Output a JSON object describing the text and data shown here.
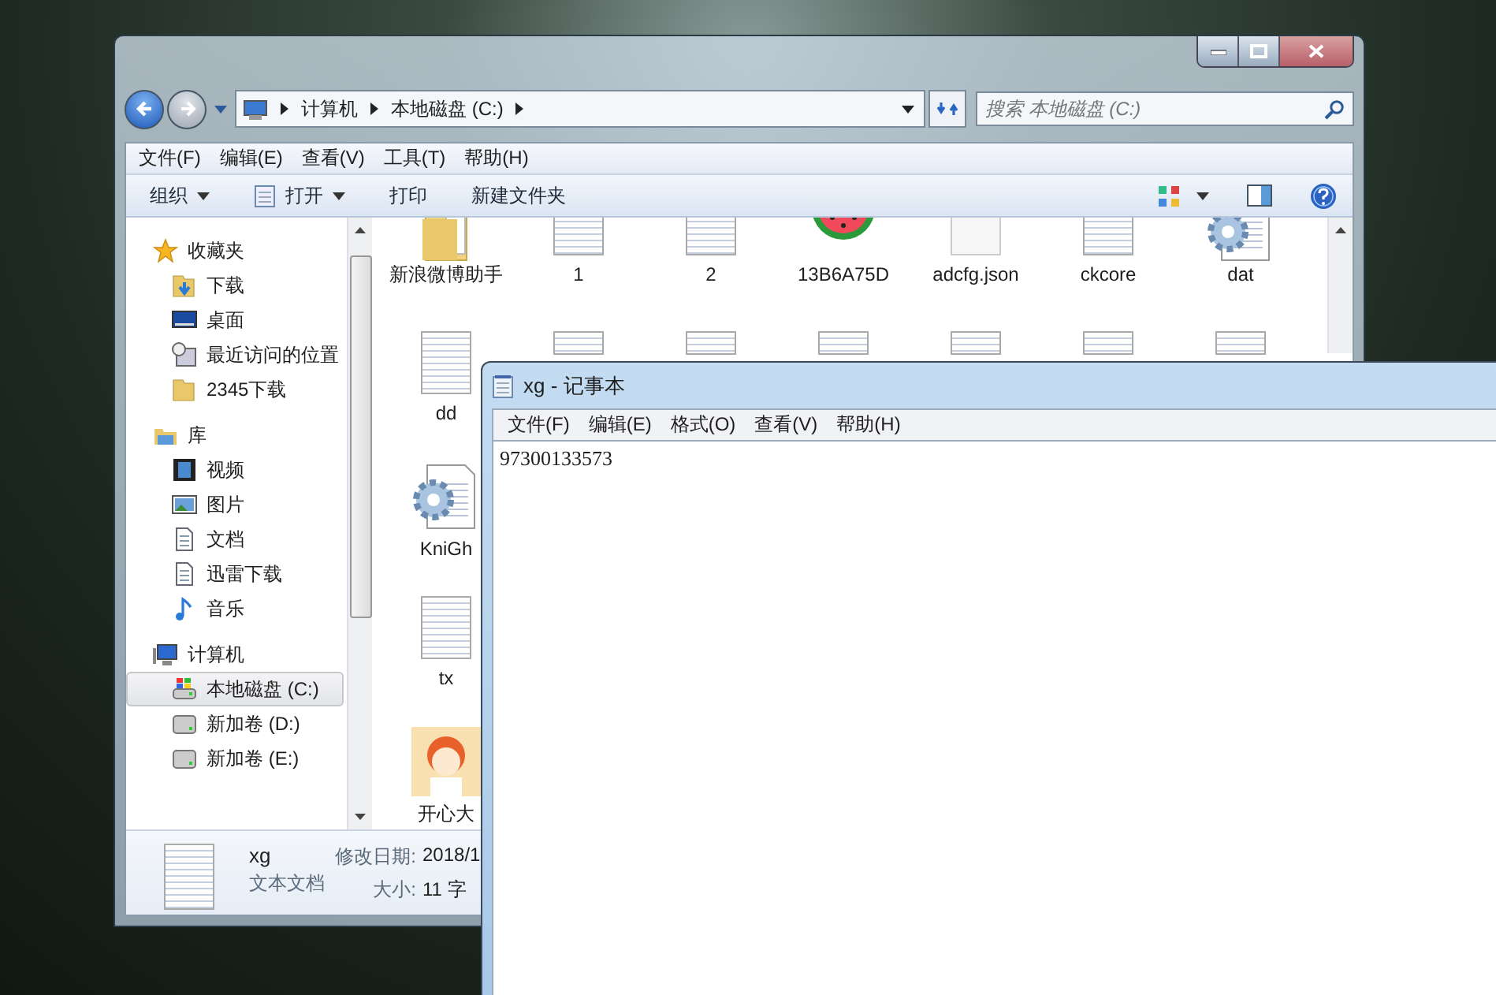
{
  "explorer": {
    "address_path": [
      "计算机",
      "本地磁盘 (C:)"
    ],
    "search": {
      "placeholder": "搜索 本地磁盘 (C:)"
    },
    "menu": [
      "文件(F)",
      "编辑(E)",
      "查看(V)",
      "工具(T)",
      "帮助(H)"
    ],
    "toolbar": [
      {
        "label": "组织",
        "kind": "dropdown"
      },
      {
        "label": "打开",
        "kind": "icon-dropdown"
      },
      {
        "label": "打印",
        "kind": "plain"
      },
      {
        "label": "新建文件夹",
        "kind": "plain"
      }
    ],
    "sidebar": [
      {
        "label": "收藏夹",
        "kind": "star",
        "children": [
          {
            "label": "下载",
            "kind": "download",
            "selected": false
          },
          {
            "label": "桌面",
            "kind": "desktop",
            "selected": false
          },
          {
            "label": "最近访问的位置",
            "kind": "recent",
            "selected": false
          },
          {
            "label": "2345下载",
            "kind": "folder",
            "selected": false
          }
        ]
      },
      {
        "label": "库",
        "kind": "library",
        "children": [
          {
            "label": "视频",
            "kind": "video",
            "selected": false
          },
          {
            "label": "图片",
            "kind": "picture",
            "selected": false
          },
          {
            "label": "文档",
            "kind": "document",
            "selected": false
          },
          {
            "label": "迅雷下载",
            "kind": "document",
            "selected": false
          },
          {
            "label": "音乐",
            "kind": "music",
            "selected": false
          }
        ]
      },
      {
        "label": "计算机",
        "kind": "computer",
        "children": [
          {
            "label": "本地磁盘 (C:)",
            "kind": "system-drive",
            "selected": true
          },
          {
            "label": "新加卷 (D:)",
            "kind": "drive",
            "selected": false
          },
          {
            "label": "新加卷 (E:)",
            "kind": "drive",
            "selected": false
          }
        ]
      }
    ],
    "file_rows": [
      [
        {
          "label": "新浪微博助手",
          "kind": "folder"
        },
        {
          "label": "1",
          "kind": "text"
        },
        {
          "label": "2",
          "kind": "text"
        },
        {
          "label": "13B6A75D",
          "kind": "watermelon"
        },
        {
          "label": "adcfg.json",
          "kind": "blank"
        },
        {
          "label": "ckcore",
          "kind": "text"
        },
        {
          "label": "dat",
          "kind": "settings"
        }
      ],
      [
        {
          "label": "dd",
          "kind": "text"
        },
        {
          "kind": "text"
        },
        {
          "kind": "text"
        },
        {
          "kind": "text"
        },
        {
          "kind": "text"
        },
        {
          "kind": "text"
        },
        {
          "kind": "text"
        }
      ],
      [
        {
          "label": "KniGh",
          "kind": "settings"
        }
      ],
      [
        {
          "label": "tx",
          "kind": "text"
        }
      ],
      [
        {
          "label": "开心大",
          "kind": "cartoon"
        }
      ]
    ],
    "details": {
      "name": "xg",
      "type": "文本文档",
      "fields": [
        {
          "label": "修改日期:",
          "value": "2018/1"
        },
        {
          "label": "大小:",
          "value": "11 字"
        }
      ]
    }
  },
  "notepad": {
    "title": "xg - 记事本",
    "menu": [
      "文件(F)",
      "编辑(E)",
      "格式(O)",
      "查看(V)",
      "帮助(H)"
    ],
    "content": "97300133573"
  }
}
